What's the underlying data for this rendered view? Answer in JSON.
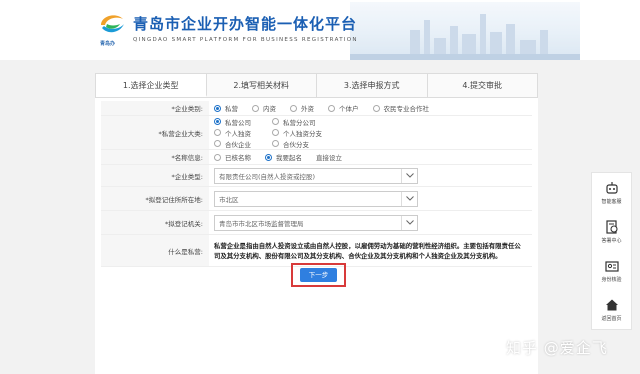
{
  "header": {
    "logo_sub": "青岛办",
    "title": "青岛市企业开办智能一体化平台",
    "subtitle": "QINGDAO SMART PLATFORM FOR BUSINESS REGISTRATION"
  },
  "tabs": [
    {
      "label": "1.选择企业类型"
    },
    {
      "label": "2.填写相关材料"
    },
    {
      "label": "3.选择申报方式"
    },
    {
      "label": "4.提交审批"
    }
  ],
  "form": {
    "enterprise_category": {
      "label": "*企业类别:",
      "options": [
        "私营",
        "内资",
        "外资",
        "个体户",
        "农民专业合作社"
      ],
      "selected": "私营"
    },
    "private_major": {
      "label": "*私营企业大类:",
      "options": [
        "私营公司",
        "私营分公司",
        "个人独资",
        "个人独资分支",
        "合伙企业",
        "合伙分支"
      ],
      "selected": "私营公司"
    },
    "name_info": {
      "label": "*名称信息:",
      "options": [
        "已核名称",
        "我要起名",
        "直接设立"
      ],
      "selected": "我要起名"
    },
    "enterprise_type": {
      "label": "*企业类型:",
      "value": "有限责任公司(自然人投资或控股)"
    },
    "location": {
      "label": "*拟登记住所所在地:",
      "value": "市北区"
    },
    "authority": {
      "label": "*拟登记机关:",
      "value": "青岛市市北区市场监督管理局"
    },
    "what_is_private": {
      "label": "什么是私营:",
      "text": "私营企业是指由自然人投资设立或由自然人控股，以雇佣劳动为基础的营利性经济组织。主要包括有限责任公司及其分支机构、股份有限公司及其分支机构、合伙企业及其分支机构和个人独资企业及其分支机构。"
    },
    "next_label": "下一步"
  },
  "floatbar": {
    "items": [
      {
        "label": "智能客服",
        "icon": "robot-icon"
      },
      {
        "label": "答署中心",
        "icon": "document-sign-icon"
      },
      {
        "label": "身份核验",
        "icon": "id-card-icon"
      },
      {
        "label": "返回首页",
        "icon": "home-icon"
      }
    ]
  },
  "watermark": "知乎 @爱企飞",
  "colors": {
    "brand": "#1b5fb3",
    "primary_button": "#2f7fe0",
    "highlight_border": "#d83a3a",
    "radio_checked": "#1e72c9"
  }
}
